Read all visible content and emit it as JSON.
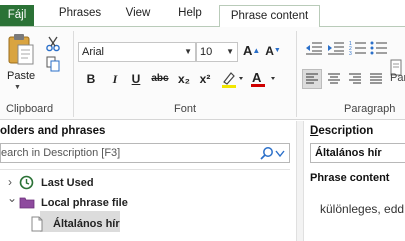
{
  "tabs": {
    "file": "Fájl",
    "phrases": "Phrases",
    "view": "View",
    "help": "Help",
    "phrase_content": "Phrase content"
  },
  "ribbon": {
    "clipboard": {
      "paste_label": "Paste",
      "group_label": "Clipboard"
    },
    "font": {
      "group_label": "Font",
      "font_name": "Arial",
      "font_size": "10",
      "bold": "B",
      "italic": "I",
      "underline": "U",
      "strikethrough": "abc",
      "subscript": "x₂",
      "superscript": "x²",
      "grow": "A",
      "shrink": "A",
      "font_color": "A",
      "highlight_color": "#f2e600",
      "font_color_value": "#d00000"
    },
    "paragraph": {
      "group_label": "Paragraph",
      "partial_label": "Para"
    }
  },
  "left_pane": {
    "title": "olders and phrases",
    "search_placeholder": "earch in Description [F3]",
    "tree": [
      {
        "label": "Last Used",
        "icon": "clock-icon",
        "expander": "›"
      },
      {
        "label": "Local phrase file",
        "icon": "folder-icon",
        "expander": "⌄"
      },
      {
        "label": "Általános hír",
        "icon": "document-icon",
        "expander": ""
      }
    ]
  },
  "right_pane": {
    "description_label_underlined": "D",
    "description_label_rest": "escription",
    "description_value": "Általános hír",
    "content_label": "Phrase content",
    "content_text": "különleges, edd"
  },
  "colors": {
    "file_tab_bg": "#2b7236",
    "accent_blue": "#2a6fc9"
  }
}
